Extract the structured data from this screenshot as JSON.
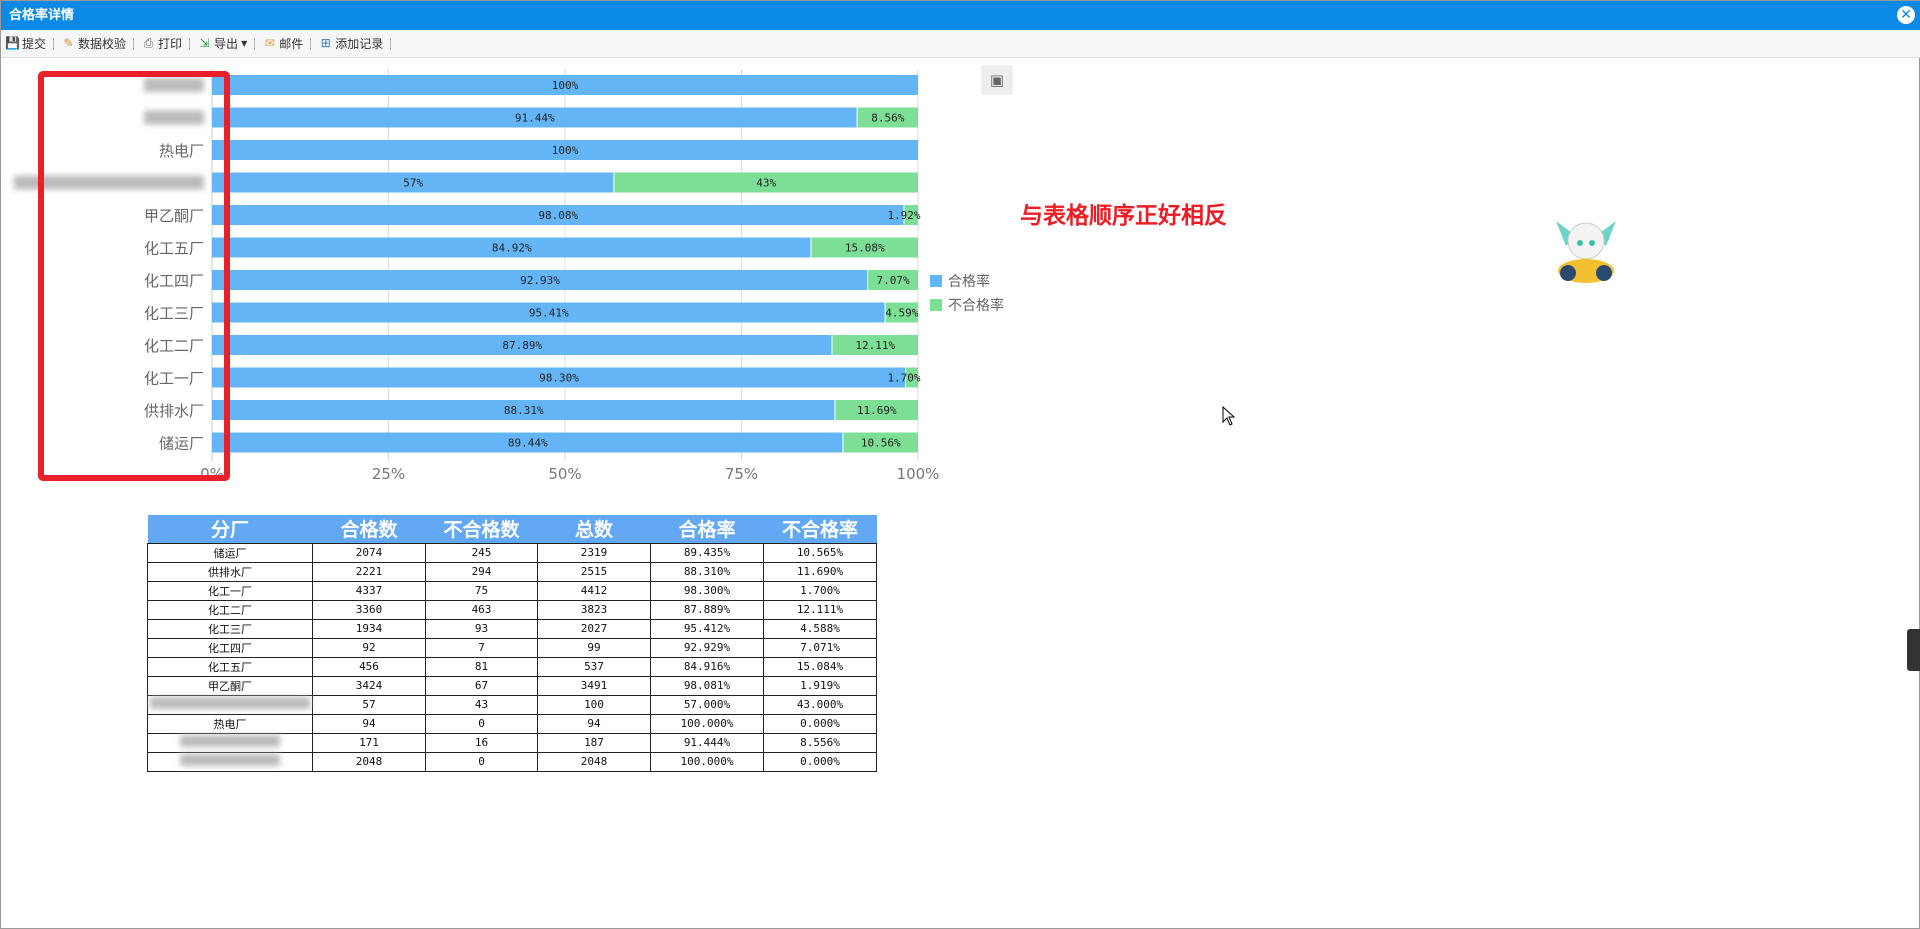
{
  "window": {
    "title": "合格率详情"
  },
  "toolbar": [
    {
      "label": "提交",
      "icon": "save-icon"
    },
    {
      "label": "数据校验",
      "icon": "pencil-icon"
    },
    {
      "label": "打印",
      "icon": "printer-icon"
    },
    {
      "label": "导出",
      "icon": "export-icon",
      "dropdown": true
    },
    {
      "label": "邮件",
      "icon": "mail-icon"
    },
    {
      "label": "添加记录",
      "icon": "add-record-icon"
    }
  ],
  "annotation": "与表格顺序正好相反",
  "chart_data": {
    "type": "bar",
    "orientation": "horizontal-stacked-percent",
    "categories": [
      "储运厂",
      "供排水厂",
      "化工一厂",
      "化工二厂",
      "化工三厂",
      "化工四厂",
      "化工五厂",
      "甲乙酮厂",
      "",
      "热电厂",
      "",
      ""
    ],
    "series": [
      {
        "name": "合格率",
        "color": "#64b5f6",
        "values": [
          89.44,
          88.31,
          98.3,
          87.89,
          95.41,
          92.93,
          84.92,
          98.08,
          57,
          100,
          91.44,
          100
        ],
        "labels": [
          "89.44%",
          "88.31%",
          "98.30%",
          "87.89%",
          "95.41%",
          "92.93%",
          "84.92%",
          "98.08%",
          "57%",
          "100%",
          "91.44%",
          "100%"
        ]
      },
      {
        "name": "不合格率",
        "color": "#7ddf96",
        "values": [
          10.56,
          11.69,
          1.7,
          12.11,
          4.59,
          7.07,
          15.08,
          1.92,
          43,
          0,
          8.56,
          0
        ],
        "labels": [
          "10.56%",
          "11.69%",
          "1.70%",
          "12.11%",
          "4.59%",
          "7.07%",
          "15.08%",
          "1.92%",
          "43%",
          "",
          "8.56%",
          ""
        ]
      }
    ],
    "xticks": [
      "0%",
      "25%",
      "50%",
      "75%",
      "100%"
    ],
    "xlim": [
      0,
      100
    ],
    "legend": "right"
  },
  "table": {
    "headers": [
      "分厂",
      "合格数",
      "不合格数",
      "总数",
      "合格率",
      "不合格率"
    ],
    "rows": [
      [
        "储运厂",
        "2074",
        "245",
        "2319",
        "89.435%",
        "10.565%"
      ],
      [
        "供排水厂",
        "2221",
        "294",
        "2515",
        "88.310%",
        "11.690%"
      ],
      [
        "化工一厂",
        "4337",
        "75",
        "4412",
        "98.300%",
        "1.700%"
      ],
      [
        "化工二厂",
        "3360",
        "463",
        "3823",
        "87.889%",
        "12.111%"
      ],
      [
        "化工三厂",
        "1934",
        "93",
        "2027",
        "95.412%",
        "4.588%"
      ],
      [
        "化工四厂",
        "92",
        "7",
        "99",
        "92.929%",
        "7.071%"
      ],
      [
        "化工五厂",
        "456",
        "81",
        "537",
        "84.916%",
        "15.084%"
      ],
      [
        "甲乙酮厂",
        "3424",
        "67",
        "3491",
        "98.081%",
        "1.919%"
      ],
      [
        "",
        "57",
        "43",
        "100",
        "57.000%",
        "43.000%"
      ],
      [
        "热电厂",
        "94",
        "0",
        "94",
        "100.000%",
        "0.000%"
      ],
      [
        "",
        "171",
        "16",
        "187",
        "91.444%",
        "8.556%"
      ],
      [
        "",
        "2048",
        "0",
        "2048",
        "100.000%",
        "0.000%"
      ]
    ]
  }
}
